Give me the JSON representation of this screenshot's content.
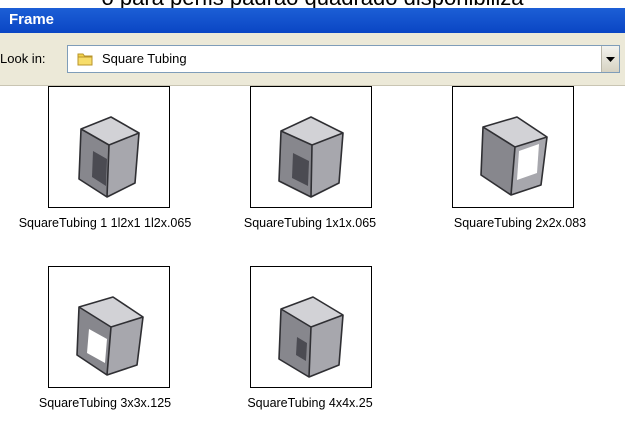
{
  "header_caption": "o para perfis padrão quadrado disponibiliza",
  "window": {
    "title": "Frame"
  },
  "look_in": {
    "label": "Look in:",
    "folder_icon": "folder-icon",
    "selected": "Square Tubing",
    "arrow_icon": "chevron-down-icon"
  },
  "files": [
    {
      "name": "SquareTubing 1 1l2x1 1l2x.065",
      "icon": "square-tube-icon"
    },
    {
      "name": "SquareTubing 1x1x.065",
      "icon": "square-tube-icon"
    },
    {
      "name": "SquareTubing 2x2x.083",
      "icon": "square-tube-icon"
    },
    {
      "name": "SquareTubing 3x3x.125",
      "icon": "square-tube-icon"
    },
    {
      "name": "SquareTubing 4x4x.25",
      "icon": "square-tube-icon"
    }
  ]
}
